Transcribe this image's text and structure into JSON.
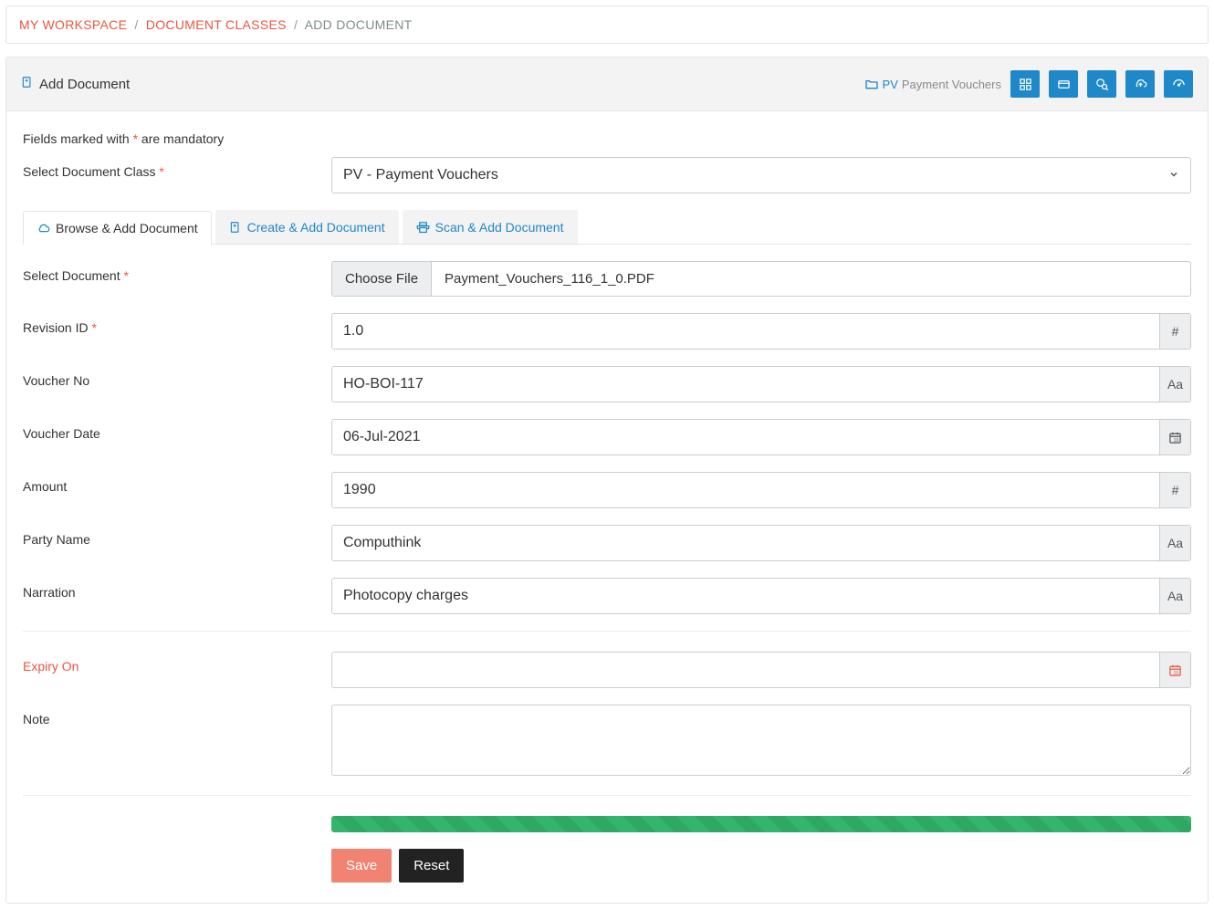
{
  "breadcrumb": {
    "workspace": "MY WORKSPACE",
    "doc_classes": "DOCUMENT CLASSES",
    "current": "ADD DOCUMENT"
  },
  "panel": {
    "title": "Add Document",
    "folder_code": "PV",
    "folder_name": "Payment Vouchers"
  },
  "hint": {
    "prefix": "Fields marked with ",
    "star": "*",
    "suffix": " are mandatory"
  },
  "labels": {
    "select_doc_class": "Select Document Class ",
    "select_document": "Select Document ",
    "revision_id": "Revision ID ",
    "voucher_no": "Voucher No",
    "voucher_date": "Voucher Date",
    "amount": "Amount",
    "party_name": "Party Name",
    "narration": "Narration",
    "expiry_on": "Expiry On",
    "note": "Note"
  },
  "select_doc_class_value": "PV - Payment Vouchers",
  "tabs": {
    "browse": "Browse & Add Document",
    "create": "Create & Add Document",
    "scan": "Scan & Add Document"
  },
  "file": {
    "choose_label": "Choose File",
    "filename": "Payment_Vouchers_116_1_0.PDF"
  },
  "values": {
    "revision_id": "1.0",
    "voucher_no": "HO-BOI-117",
    "voucher_date": "06-Jul-2021",
    "amount": "1990",
    "party_name": "Computhink",
    "narration": "Photocopy charges",
    "expiry_on": "",
    "note": ""
  },
  "addons": {
    "hash": "#",
    "aa": "Aa"
  },
  "buttons": {
    "save": "Save",
    "reset": "Reset"
  }
}
